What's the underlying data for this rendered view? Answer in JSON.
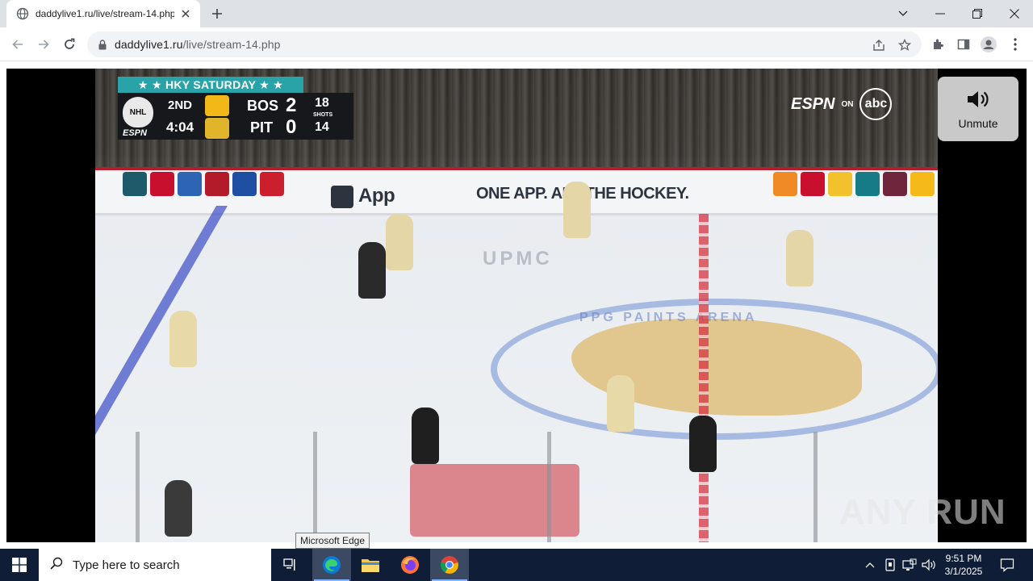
{
  "browser": {
    "tab": {
      "title": "daddylive1.ru/live/stream-14.php"
    },
    "address": {
      "host": "daddylive1.ru",
      "path": "/live/stream-14.php"
    }
  },
  "scorebug": {
    "banner": "★ ★  HKY SATURDAY  ★ ★",
    "period": "2ND",
    "clock": "4:04",
    "away": {
      "abbr": "BOS",
      "score": "2",
      "shots": "18"
    },
    "home": {
      "abbr": "PIT",
      "score": "0",
      "shots": "14"
    },
    "shots_label": "SHOTS",
    "league": "NHL",
    "network_small": "ESPN"
  },
  "broadcast": {
    "network": "ESPN",
    "on": "ON",
    "partner": "abc"
  },
  "rink": {
    "boards_app": "App",
    "boards_slogan": "ONE APP. ALL THE HOCKEY.",
    "ice_sponsor": "UPMC",
    "arena": "PPG PAINTS ARENA"
  },
  "player_controls": {
    "unmute_label": "Unmute"
  },
  "tooltip": "Microsoft Edge",
  "watermark": "ANY RUN",
  "taskbar": {
    "search_placeholder": "Type here to search",
    "time": "9:51 PM",
    "date": "3/1/2025"
  },
  "colors": {
    "tabstrip": "#dee1e6",
    "scorebug_banner": "#2aa3a8",
    "taskbar": "#0f1e36",
    "boards_stripe": "#b21e2b"
  },
  "icons": [
    "globe-icon",
    "close-icon",
    "plus-icon",
    "chevron-down-icon",
    "minimize-icon",
    "restore-icon",
    "window-close-icon",
    "back-icon",
    "forward-icon",
    "reload-icon",
    "lock-icon",
    "share-icon",
    "star-icon",
    "extensions-icon",
    "side-panel-icon",
    "profile-icon",
    "menu-icon",
    "speaker-icon",
    "windows-logo-icon",
    "search-icon",
    "task-view-icon",
    "edge-icon",
    "file-explorer-icon",
    "firefox-icon",
    "chrome-icon",
    "chevron-up-icon",
    "network-icon",
    "volume-icon",
    "notification-icon"
  ]
}
